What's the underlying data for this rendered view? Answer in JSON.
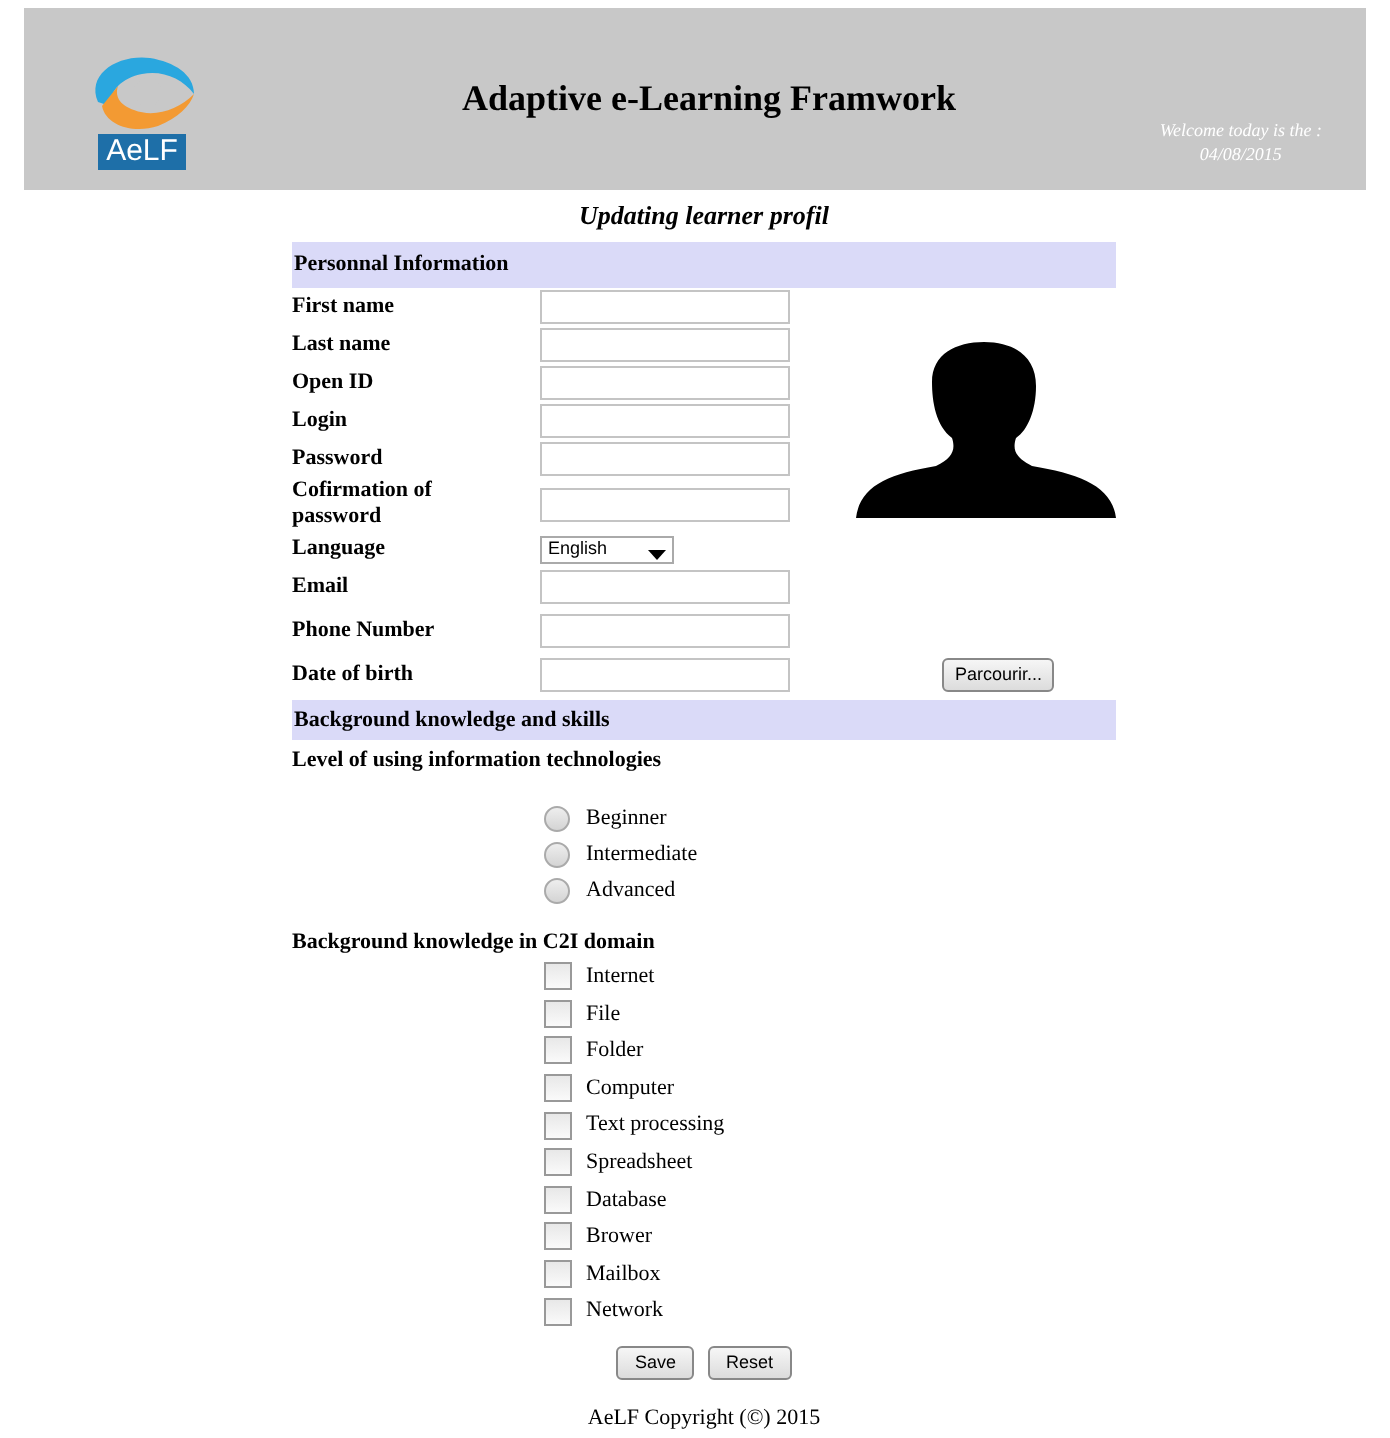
{
  "header": {
    "logo_text": "AeLF",
    "title": "Adaptive e-Learning Framwork",
    "welcome": "Welcome today is the :",
    "date": "04/08/2015"
  },
  "page_title": "Updating learner profil",
  "personal": {
    "heading": "Personnal Information",
    "fields": [
      {
        "label": "First name",
        "kind": "text"
      },
      {
        "label": "Last name",
        "kind": "text"
      },
      {
        "label": "Open ID",
        "kind": "text"
      },
      {
        "label": "Login",
        "kind": "text"
      },
      {
        "label": "Password",
        "kind": "text"
      },
      {
        "label": "Cofirmation of password",
        "kind": "text"
      },
      {
        "label": "Language",
        "kind": "select",
        "value": "English"
      },
      {
        "label": "Email",
        "kind": "text"
      },
      {
        "label": "Phone Number",
        "kind": "text"
      },
      {
        "label": "Date of birth",
        "kind": "text"
      }
    ],
    "browse_button": "Parcourir..."
  },
  "background": {
    "heading": "Background knowledge and skills",
    "level_question": "Level of using information technologies",
    "levels": [
      {
        "label": "Beginner",
        "selected": false
      },
      {
        "label": "Intermediate",
        "selected": false
      },
      {
        "label": "Advanced",
        "selected": false
      }
    ],
    "domain_question": "Background knowledge in C2I domain",
    "domains": [
      {
        "label": "Internet",
        "checked": false
      },
      {
        "label": "File",
        "checked": false
      },
      {
        "label": "Folder",
        "checked": false
      },
      {
        "label": "Computer",
        "checked": false
      },
      {
        "label": "Text processing",
        "checked": false
      },
      {
        "label": "Spreadsheet",
        "checked": false
      },
      {
        "label": "Database",
        "checked": false
      },
      {
        "label": "Brower",
        "checked": false
      },
      {
        "label": "Mailbox",
        "checked": false
      },
      {
        "label": "Network",
        "checked": false
      }
    ]
  },
  "buttons": [
    "Save",
    "Reset"
  ],
  "footer": "AeLF Copyright (©) 2015"
}
